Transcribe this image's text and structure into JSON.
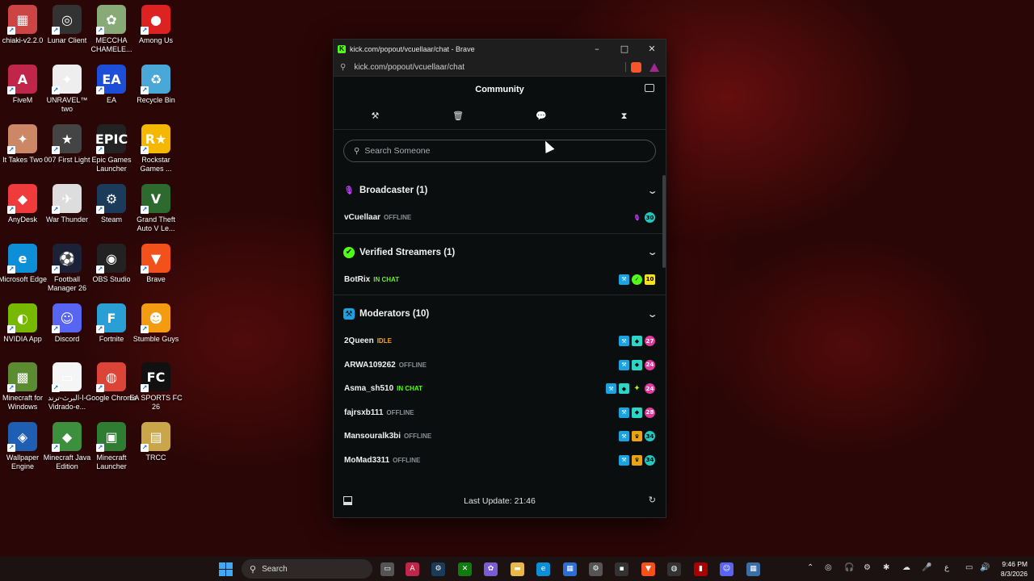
{
  "desktop": {
    "icons": [
      {
        "label": "chiaki-v2.2.0",
        "glyph": "▦",
        "color": "#c44"
      },
      {
        "label": "Lunar Client",
        "glyph": "◎",
        "color": "#333"
      },
      {
        "label": "MECCHA CHAMELE...",
        "glyph": "✿",
        "color": "#8a7"
      },
      {
        "label": "Among Us",
        "glyph": "●",
        "color": "#d22"
      },
      {
        "label": "FiveM",
        "glyph": "A",
        "color": "#c0254a"
      },
      {
        "label": "UNRAVEL™ two",
        "glyph": "✦",
        "color": "#eee"
      },
      {
        "label": "EA",
        "glyph": "EA",
        "color": "#1d4ed8"
      },
      {
        "label": "Recycle Bin",
        "glyph": "♻",
        "color": "#4aa8d8"
      },
      {
        "label": "It Takes Two",
        "glyph": "✦",
        "color": "#c86"
      },
      {
        "label": "007 First Light",
        "glyph": "★",
        "color": "#444"
      },
      {
        "label": "Epic Games Launcher",
        "glyph": "EPIC",
        "color": "#222"
      },
      {
        "label": "Rockstar Games ...",
        "glyph": "R★",
        "color": "#f5b800"
      },
      {
        "label": "AnyDesk",
        "glyph": "◆",
        "color": "#ef3b3b"
      },
      {
        "label": "War Thunder",
        "glyph": "✈",
        "color": "#ddd"
      },
      {
        "label": "Steam",
        "glyph": "⚙",
        "color": "#1b3b5a"
      },
      {
        "label": "Grand Theft Auto V Le...",
        "glyph": "V",
        "color": "#2d6a2d"
      },
      {
        "label": "Microsoft Edge",
        "glyph": "e",
        "color": "#0c8fd6"
      },
      {
        "label": "Football Manager 26",
        "glyph": "⚽",
        "color": "#1b2238"
      },
      {
        "label": "OBS Studio",
        "glyph": "◉",
        "color": "#222"
      },
      {
        "label": "Brave",
        "glyph": "▼",
        "color": "#f2511b"
      },
      {
        "label": "NVIDIA App",
        "glyph": "◐",
        "color": "#76b900"
      },
      {
        "label": "Discord",
        "glyph": "☺",
        "color": "#5865f2"
      },
      {
        "label": "Fortnite",
        "glyph": "F",
        "color": "#2a9fd6"
      },
      {
        "label": "Stumble Guys",
        "glyph": "☻",
        "color": "#f39c12"
      },
      {
        "label": "Minecraft for Windows",
        "glyph": "▩",
        "color": "#5b8c32"
      },
      {
        "label": "ا-البرث-ترند-Vidrado-e...",
        "glyph": "▭",
        "color": "#f5f5f5"
      },
      {
        "label": "Google Chrome",
        "glyph": "◍",
        "color": "#db4437"
      },
      {
        "label": "EA SPORTS FC 26",
        "glyph": "FC",
        "color": "#111"
      },
      {
        "label": "Wallpaper Engine",
        "glyph": "◈",
        "color": "#1e5fb4"
      },
      {
        "label": "Minecraft Java Edition",
        "glyph": "◆",
        "color": "#3c8f3c"
      },
      {
        "label": "Minecraft Launcher",
        "glyph": "▣",
        "color": "#2e7d32"
      },
      {
        "label": "TRCC",
        "glyph": "▤",
        "color": "#c9a64a"
      }
    ]
  },
  "window": {
    "title": "kick.com/popout/vcuellaar/chat - Brave",
    "url": "kick.com/popout/vcuellaar/chat",
    "minimize": "–",
    "maximize": "□",
    "close": "✕"
  },
  "panel": {
    "header": "Community",
    "tools": [
      "hammer-icon",
      "trash-icon",
      "chat-icon",
      "hourglass-icon"
    ],
    "search_placeholder": "Search Someone",
    "footer": "Last Update: 21:46"
  },
  "sections": [
    {
      "name": "Broadcaster (1)",
      "icon": "microphone-icon",
      "icon_color": "#c541ff",
      "users": [
        {
          "name": "vCuellaar",
          "status": "OFFLINE",
          "status_class": "status-offline",
          "badges": [
            {
              "cls": "b-mic",
              "txt": "🎙"
            },
            {
              "cls": "b-sub-teal",
              "txt": "30"
            }
          ]
        }
      ]
    },
    {
      "name": "Verified Streamers (1)",
      "icon": "verified-icon",
      "icon_color": "#53fc18",
      "users": [
        {
          "name": "BotRix",
          "status": "IN CHAT",
          "status_class": "status-inchat",
          "badges": [
            {
              "cls": "b-mod",
              "txt": "⚒"
            },
            {
              "cls": "b-green",
              "txt": "✓"
            },
            {
              "cls": "b-sub-yellow",
              "txt": "10"
            }
          ]
        }
      ]
    },
    {
      "name": "Moderators (10)",
      "icon": "moderator-icon",
      "icon_color": "#1aa3e0",
      "users": [
        {
          "name": "2Queen",
          "status": "IDLE",
          "status_class": "status-idle",
          "badges": [
            {
              "cls": "b-mod",
              "txt": "⚒"
            },
            {
              "cls": "b-vip",
              "txt": "◆"
            },
            {
              "cls": "b-sub-pink",
              "txt": "27"
            }
          ]
        },
        {
          "name": "ARWA109262",
          "status": "OFFLINE",
          "status_class": "status-offline",
          "badges": [
            {
              "cls": "b-mod",
              "txt": "⚒"
            },
            {
              "cls": "b-vip",
              "txt": "◆"
            },
            {
              "cls": "b-sub-pink",
              "txt": "24"
            }
          ]
        },
        {
          "name": "Asma_sh510",
          "status": "IN CHAT",
          "status_class": "status-inchat",
          "badges": [
            {
              "cls": "b-mod",
              "txt": "⚒"
            },
            {
              "cls": "b-vip",
              "txt": "◆"
            },
            {
              "cls": "b-diamond",
              "txt": "✦"
            },
            {
              "cls": "b-sub-pink",
              "txt": "24"
            }
          ]
        },
        {
          "name": "fajrsxb111",
          "status": "OFFLINE",
          "status_class": "status-offline",
          "badges": [
            {
              "cls": "b-mod",
              "txt": "⚒"
            },
            {
              "cls": "b-vip",
              "txt": "◆"
            },
            {
              "cls": "b-sub-pink",
              "txt": "28"
            }
          ]
        },
        {
          "name": "Mansouralk3bi",
          "status": "OFFLINE",
          "status_class": "status-offline",
          "badges": [
            {
              "cls": "b-mod",
              "txt": "⚒"
            },
            {
              "cls": "b-crown",
              "txt": "♛"
            },
            {
              "cls": "b-sub-teal",
              "txt": "34"
            }
          ]
        },
        {
          "name": "MoMad3311",
          "status": "OFFLINE",
          "status_class": "status-offline",
          "badges": [
            {
              "cls": "b-mod",
              "txt": "⚒"
            },
            {
              "cls": "b-crown",
              "txt": "♛"
            },
            {
              "cls": "b-sub-teal",
              "txt": "34"
            }
          ]
        }
      ]
    }
  ],
  "taskbar": {
    "search_label": "Search",
    "time": "9:46 PM",
    "date": "8/3/2026",
    "lang": "ع"
  }
}
